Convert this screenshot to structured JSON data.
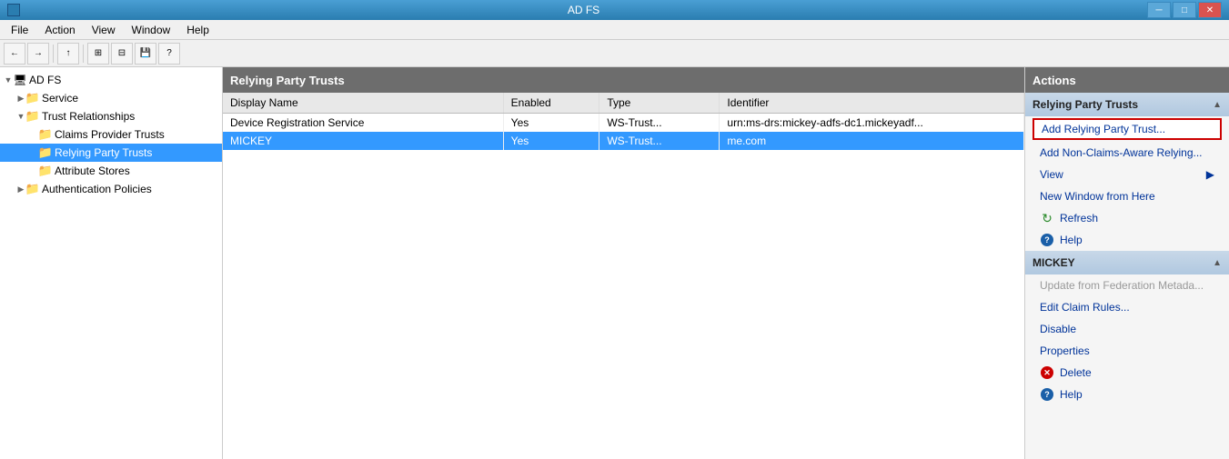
{
  "titleBar": {
    "title": "AD FS",
    "minBtn": "─",
    "maxBtn": "□",
    "closeBtn": "✕",
    "appIconColor": "#2a7db0"
  },
  "menuBar": {
    "items": [
      "File",
      "Action",
      "View",
      "Window",
      "Help"
    ]
  },
  "toolbar": {
    "buttons": [
      "←",
      "→",
      "↑",
      "⊞",
      "⊟",
      "🖫",
      "?"
    ]
  },
  "tree": {
    "items": [
      {
        "label": "AD FS",
        "indent": 0,
        "type": "root",
        "expanded": true,
        "selected": false
      },
      {
        "label": "Service",
        "indent": 1,
        "type": "folder",
        "expanded": false,
        "selected": false
      },
      {
        "label": "Trust Relationships",
        "indent": 1,
        "type": "folder",
        "expanded": true,
        "selected": false
      },
      {
        "label": "Claims Provider Trusts",
        "indent": 2,
        "type": "folder",
        "expanded": false,
        "selected": false
      },
      {
        "label": "Relying Party Trusts",
        "indent": 2,
        "type": "folder",
        "expanded": false,
        "selected": true
      },
      {
        "label": "Attribute Stores",
        "indent": 2,
        "type": "folder",
        "expanded": false,
        "selected": false
      },
      {
        "label": "Authentication Policies",
        "indent": 1,
        "type": "folder",
        "expanded": false,
        "selected": false
      }
    ]
  },
  "centerPanel": {
    "header": "Relying Party Trusts",
    "columns": [
      {
        "label": "Display Name",
        "width": "35%"
      },
      {
        "label": "Enabled",
        "width": "12%"
      },
      {
        "label": "Type",
        "width": "15%"
      },
      {
        "label": "Identifier",
        "width": "38%"
      }
    ],
    "rows": [
      {
        "displayName": "Device Registration Service",
        "enabled": "Yes",
        "type": "WS-Trust...",
        "identifier": "urn:ms-drs:mickey-adfs-dc1.mickeyadf...",
        "selected": false
      },
      {
        "displayName": "MICKEY",
        "enabled": "Yes",
        "type": "WS-Trust...",
        "identifier": "me.com",
        "selected": true
      }
    ]
  },
  "actionsPanel": {
    "header": "Actions",
    "sections": [
      {
        "label": "Relying Party Trusts",
        "items": [
          {
            "label": "Add Relying Party Trust...",
            "highlighted": true,
            "disabled": false,
            "icon": ""
          },
          {
            "label": "Add Non-Claims-Aware Relying...",
            "highlighted": false,
            "disabled": false,
            "icon": ""
          },
          {
            "label": "View",
            "highlighted": false,
            "disabled": false,
            "icon": "",
            "hasArrow": true
          },
          {
            "label": "New Window from Here",
            "highlighted": false,
            "disabled": false,
            "icon": ""
          },
          {
            "label": "Refresh",
            "highlighted": false,
            "disabled": false,
            "icon": "refresh"
          },
          {
            "label": "Help",
            "highlighted": false,
            "disabled": false,
            "icon": "help"
          }
        ]
      },
      {
        "label": "MICKEY",
        "items": [
          {
            "label": "Update from Federation Metada...",
            "highlighted": false,
            "disabled": true,
            "icon": ""
          },
          {
            "label": "Edit Claim Rules...",
            "highlighted": false,
            "disabled": false,
            "icon": ""
          },
          {
            "label": "Disable",
            "highlighted": false,
            "disabled": false,
            "icon": ""
          },
          {
            "label": "Properties",
            "highlighted": false,
            "disabled": false,
            "icon": ""
          },
          {
            "label": "Delete",
            "highlighted": false,
            "disabled": false,
            "icon": "delete"
          },
          {
            "label": "Help",
            "highlighted": false,
            "disabled": false,
            "icon": "help"
          }
        ]
      }
    ]
  }
}
